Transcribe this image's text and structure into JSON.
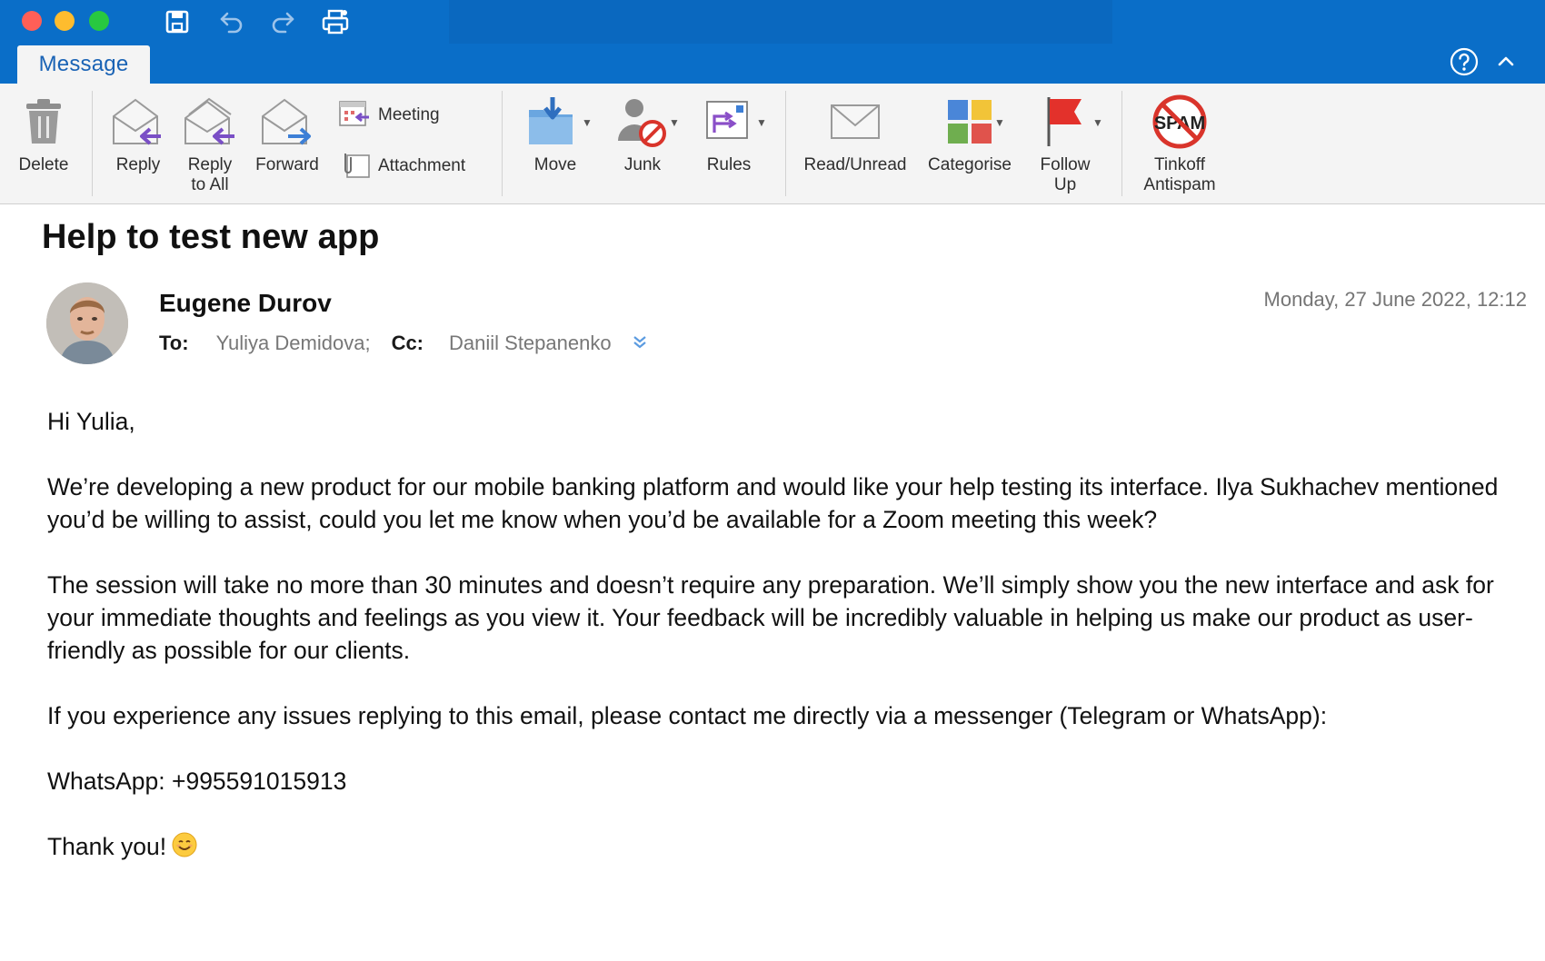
{
  "window": {
    "quick_access": [
      "save-icon",
      "undo-icon",
      "redo-icon",
      "print-icon"
    ],
    "tab_label": "Message",
    "accent_color": "#0a6ec8"
  },
  "ribbon": {
    "delete": "Delete",
    "reply": "Reply",
    "reply_all_line1": "Reply",
    "reply_all_line2": "to All",
    "forward": "Forward",
    "meeting": "Meeting",
    "attachment": "Attachment",
    "move": "Move",
    "junk": "Junk",
    "rules": "Rules",
    "read_unread": "Read/Unread",
    "categorise": "Categorise",
    "follow_up_line1": "Follow",
    "follow_up_line2": "Up",
    "tinkoff_line1": "Tinkoff",
    "tinkoff_line2": "Antispam",
    "spam_badge": "SPAM"
  },
  "message": {
    "subject": "Help to test new app",
    "sender": "Eugene Durov",
    "to_label": "To:",
    "to_value": "Yuliya Demidova;",
    "cc_label": "Cc:",
    "cc_value": "Daniil Stepanenko",
    "date": "Monday, 27 June 2022, 12:12",
    "body": {
      "greeting": "Hi Yulia,",
      "p1": "We’re developing a new product for our mobile banking platform and would like your help testing its interface. Ilya Sukhachev mentioned you’d be willing to assist, could you let me know when you’d be available for a Zoom meeting this week?",
      "p2": "The session will take no more than 30 minutes and doesn’t require any preparation. We’ll simply show you the new interface and ask for your immediate thoughts and feelings as you view it. Your feedback will be incredibly valuable in helping us make our product as user-friendly as possible for our clients.",
      "p3": "If you experience any issues replying to this email, please contact me directly via a messenger (Telegram or WhatsApp):",
      "p4": "WhatsApp: +995591015913",
      "closing": "Thank you!"
    }
  }
}
